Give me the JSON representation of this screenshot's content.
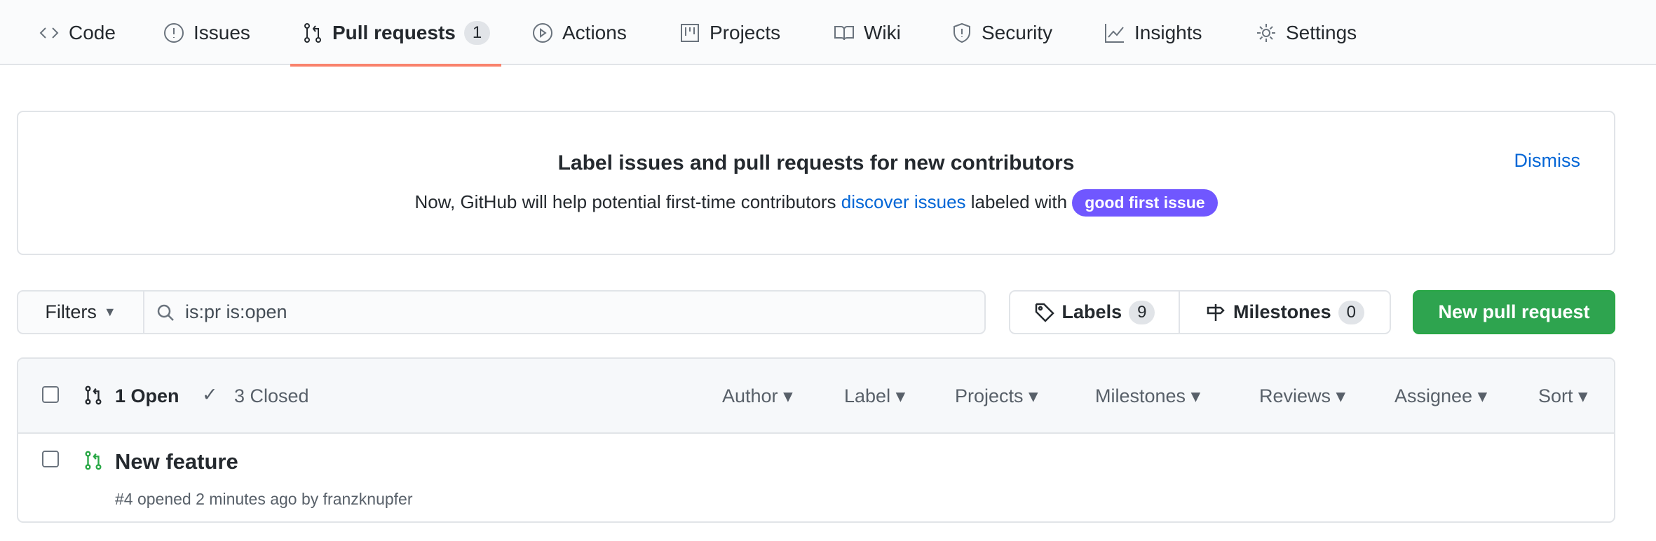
{
  "tabs": [
    {
      "label": "Code",
      "icon": "code-icon"
    },
    {
      "label": "Issues",
      "icon": "issue-icon"
    },
    {
      "label": "Pull requests",
      "icon": "pull-request-icon",
      "count": "1",
      "active": true
    },
    {
      "label": "Actions",
      "icon": "play-icon"
    },
    {
      "label": "Projects",
      "icon": "project-icon"
    },
    {
      "label": "Wiki",
      "icon": "book-icon"
    },
    {
      "label": "Security",
      "icon": "shield-icon"
    },
    {
      "label": "Insights",
      "icon": "graph-icon"
    },
    {
      "label": "Settings",
      "icon": "gear-icon"
    }
  ],
  "banner": {
    "title": "Label issues and pull requests for new contributors",
    "text_before": "Now, GitHub will help potential first-time contributors ",
    "link": "discover issues",
    "text_after": " labeled with ",
    "label": "good first issue",
    "dismiss": "Dismiss"
  },
  "toolbar": {
    "filters": "Filters",
    "search_value": "is:pr is:open",
    "labels": "Labels",
    "labels_count": "9",
    "milestones": "Milestones",
    "milestones_count": "0",
    "new_pr": "New pull request"
  },
  "list": {
    "open": "1 Open",
    "closed": "3 Closed",
    "dropdowns": [
      "Author",
      "Label",
      "Projects",
      "Milestones",
      "Reviews",
      "Assignee",
      "Sort"
    ],
    "items": [
      {
        "title": "New feature",
        "meta": "#4 opened 2 minutes ago by franzknupfer"
      }
    ]
  },
  "colors": {
    "accent": "#f9826c",
    "green": "#2ea44f",
    "link": "#0366d6",
    "label": "#7057ff"
  }
}
